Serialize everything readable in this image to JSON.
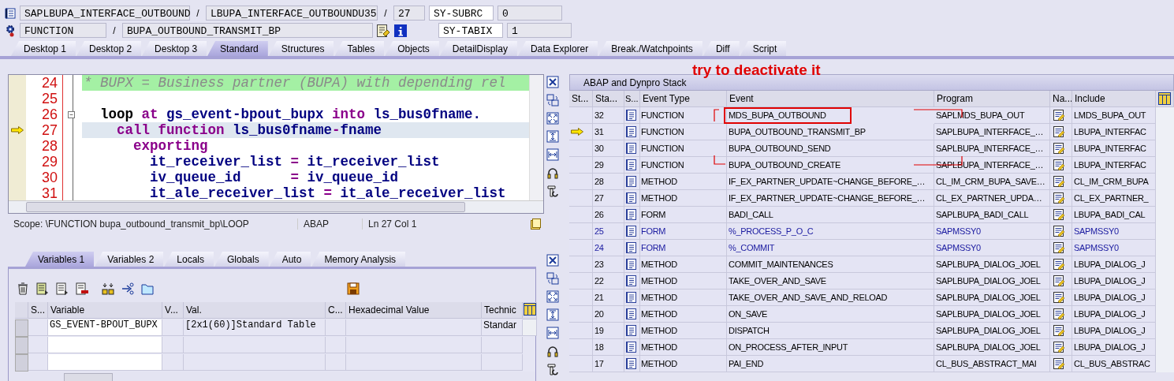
{
  "header": {
    "program": "SAPLBUPA_INTERFACE_OUTBOUND",
    "separator_1": "/",
    "include": "LBUPA_INTERFACE_OUTBOUNDU35",
    "separator_2": "/",
    "line": "27",
    "event_type": "FUNCTION",
    "separator_3": "/",
    "event": "BUPA_OUTBOUND_TRANSMIT_BP",
    "system_fields": [
      {
        "name": "SY-SUBRC",
        "value": "0"
      },
      {
        "name": "SY-TABIX",
        "value": "1"
      }
    ]
  },
  "tabs": [
    {
      "label": "Desktop 1",
      "selected": false
    },
    {
      "label": "Desktop 2",
      "selected": false
    },
    {
      "label": "Desktop 3",
      "selected": false
    },
    {
      "label": "Standard",
      "selected": true
    },
    {
      "label": "Structures",
      "selected": false
    },
    {
      "label": "Tables",
      "selected": false
    },
    {
      "label": "Objects",
      "selected": false
    },
    {
      "label": "DetailDisplay",
      "selected": false
    },
    {
      "label": "Data Explorer",
      "selected": false
    },
    {
      "label": "Break./Watchpoints",
      "selected": false
    },
    {
      "label": "Diff",
      "selected": false
    },
    {
      "label": "Script",
      "selected": false
    }
  ],
  "editor": {
    "lines": [
      {
        "number": "24",
        "current": false,
        "foldable": false,
        "kind": "comment",
        "tokens": [
          {
            "text": "* BUPX = Business partner (BUPA) with depending rel",
            "kind": "comment"
          }
        ]
      },
      {
        "number": "25",
        "current": false,
        "foldable": false,
        "kind": "code"
      },
      {
        "number": "26",
        "current": false,
        "foldable": true,
        "kind": "code",
        "tokens": [
          {
            "text": "  loop",
            "kind": "plain"
          },
          {
            "text": " at ",
            "kind": "keyword"
          },
          {
            "text": "gs_event-bpout_bupx",
            "kind": "name"
          },
          {
            "text": " into ",
            "kind": "keyword"
          },
          {
            "text": "ls_bus0fname.",
            "kind": "name"
          }
        ]
      },
      {
        "number": "27",
        "current": true,
        "foldable": false,
        "kind": "code",
        "tokens": [
          {
            "text": "    call function ",
            "kind": "keyword"
          },
          {
            "text": "ls_bus0fname",
            "kind": "name"
          },
          {
            "text": "-",
            "kind": "keyword"
          },
          {
            "text": "fname",
            "kind": "name"
          }
        ]
      },
      {
        "number": "28",
        "current": false,
        "foldable": false,
        "kind": "code",
        "tokens": [
          {
            "text": "      exporting",
            "kind": "keyword"
          }
        ]
      },
      {
        "number": "29",
        "current": false,
        "foldable": false,
        "kind": "code",
        "tokens": [
          {
            "text": "        it_receiver_list ",
            "kind": "name"
          },
          {
            "text": "=",
            "kind": "keyword"
          },
          {
            "text": " it_receiver_list",
            "kind": "name"
          }
        ]
      },
      {
        "number": "30",
        "current": false,
        "foldable": false,
        "kind": "code",
        "tokens": [
          {
            "text": "        iv_queue_id      ",
            "kind": "name"
          },
          {
            "text": "=",
            "kind": "keyword"
          },
          {
            "text": " iv_queue_id",
            "kind": "name"
          }
        ]
      },
      {
        "number": "31",
        "current": false,
        "foldable": false,
        "kind": "code",
        "tokens": [
          {
            "text": "        it_ale_receiver_list ",
            "kind": "name"
          },
          {
            "text": "=",
            "kind": "keyword"
          },
          {
            "text": " it_ale_receiver_list",
            "kind": "name"
          }
        ]
      }
    ],
    "status": {
      "scope": "Scope: \\FUNCTION bupa_outbound_transmit_bp\\LOOP",
      "language": "ABAP",
      "position": "Ln  27 Col  1"
    }
  },
  "variables": {
    "tabs": [
      {
        "label": "Variables 1",
        "selected": true
      },
      {
        "label": "Variables 2",
        "selected": false
      },
      {
        "label": "Locals",
        "selected": false
      },
      {
        "label": "Globals",
        "selected": false
      },
      {
        "label": "Auto",
        "selected": false
      },
      {
        "label": "Memory Analysis",
        "selected": false
      }
    ],
    "columns": [
      "S...",
      "Variable",
      "V...",
      "Val.",
      "C...",
      "Hexadecimal Value",
      "Technic"
    ],
    "rows": [
      {
        "variable": "GS_EVENT-BPOUT_BUPX",
        "value": "[2x1(60)]Standard Table",
        "technical_type": "Standar"
      }
    ]
  },
  "stack": {
    "title": "ABAP and Dynpro Stack",
    "annotation": "try to deactivate it",
    "columns": [
      "St...",
      "Sta...",
      "S...",
      "Event Type",
      "Event",
      "Program",
      "Na...",
      "Include"
    ],
    "rows": [
      {
        "number": "32",
        "current": false,
        "system": false,
        "boxed": true,
        "event_type": "FUNCTION",
        "event": "MDS_BUPA_OUTBOUND",
        "program": "SAPLMDS_BUPA_OUT",
        "include": "LMDS_BUPA_OUT"
      },
      {
        "number": "31",
        "current": true,
        "system": false,
        "boxed": false,
        "event_type": "FUNCTION",
        "event": "BUPA_OUTBOUND_TRANSMIT_BP",
        "program": "SAPLBUPA_INTERFACE_…",
        "include": "LBUPA_INTERFAC"
      },
      {
        "number": "30",
        "current": false,
        "system": false,
        "boxed": false,
        "event_type": "FUNCTION",
        "event": "BUPA_OUTBOUND_SEND",
        "program": "SAPLBUPA_INTERFACE_…",
        "include": "LBUPA_INTERFAC"
      },
      {
        "number": "29",
        "current": false,
        "system": false,
        "boxed": false,
        "event_type": "FUNCTION",
        "event": "BUPA_OUTBOUND_CREATE",
        "program": "SAPLBUPA_INTERFACE_…",
        "include": "LBUPA_INTERFAC"
      },
      {
        "number": "28",
        "current": false,
        "system": false,
        "boxed": false,
        "event_type": "METHOD",
        "event": "IF_EX_PARTNER_UPDATE~CHANGE_BEFORE_…",
        "program": "CL_IM_CRM_BUPA_SAVE…",
        "include": "CL_IM_CRM_BUPA"
      },
      {
        "number": "27",
        "current": false,
        "system": false,
        "boxed": false,
        "event_type": "METHOD",
        "event": "IF_EX_PARTNER_UPDATE~CHANGE_BEFORE_…",
        "program": "CL_EX_PARTNER_UPDA…",
        "include": "CL_EX_PARTNER_"
      },
      {
        "number": "26",
        "current": false,
        "system": false,
        "boxed": false,
        "event_type": "FORM",
        "event": "BADI_CALL",
        "program": "SAPLBUPA_BADI_CALL",
        "include": "LBUPA_BADI_CAL"
      },
      {
        "number": "25",
        "current": false,
        "system": true,
        "boxed": false,
        "event_type": "FORM",
        "event": "%_PROCESS_P_O_C",
        "program": "SAPMSSY0",
        "include": "SAPMSSY0"
      },
      {
        "number": "24",
        "current": false,
        "system": true,
        "boxed": false,
        "event_type": "FORM",
        "event": "%_COMMIT",
        "program": "SAPMSSY0",
        "include": "SAPMSSY0"
      },
      {
        "number": "23",
        "current": false,
        "system": false,
        "boxed": false,
        "event_type": "METHOD",
        "event": "COMMIT_MAINTENANCES",
        "program": "SAPLBUPA_DIALOG_JOEL",
        "include": "LBUPA_DIALOG_J"
      },
      {
        "number": "22",
        "current": false,
        "system": false,
        "boxed": false,
        "event_type": "METHOD",
        "event": "TAKE_OVER_AND_SAVE",
        "program": "SAPLBUPA_DIALOG_JOEL",
        "include": "LBUPA_DIALOG_J"
      },
      {
        "number": "21",
        "current": false,
        "system": false,
        "boxed": false,
        "event_type": "METHOD",
        "event": "TAKE_OVER_AND_SAVE_AND_RELOAD",
        "program": "SAPLBUPA_DIALOG_JOEL",
        "include": "LBUPA_DIALOG_J"
      },
      {
        "number": "20",
        "current": false,
        "system": false,
        "boxed": false,
        "event_type": "METHOD",
        "event": "ON_SAVE",
        "program": "SAPLBUPA_DIALOG_JOEL",
        "include": "LBUPA_DIALOG_J"
      },
      {
        "number": "19",
        "current": false,
        "system": false,
        "boxed": false,
        "event_type": "METHOD",
        "event": "DISPATCH",
        "program": "SAPLBUPA_DIALOG_JOEL",
        "include": "LBUPA_DIALOG_J"
      },
      {
        "number": "18",
        "current": false,
        "system": false,
        "boxed": false,
        "event_type": "METHOD",
        "event": "ON_PROCESS_AFTER_INPUT",
        "program": "SAPLBUPA_DIALOG_JOEL",
        "include": "LBUPA_DIALOG_J"
      },
      {
        "number": "17",
        "current": false,
        "system": false,
        "boxed": false,
        "event_type": "METHOD",
        "event": "PAI_END",
        "program": "CL_BUS_ABSTRACT_MAI",
        "include": "CL_BUS_ABSTRAC"
      }
    ]
  }
}
